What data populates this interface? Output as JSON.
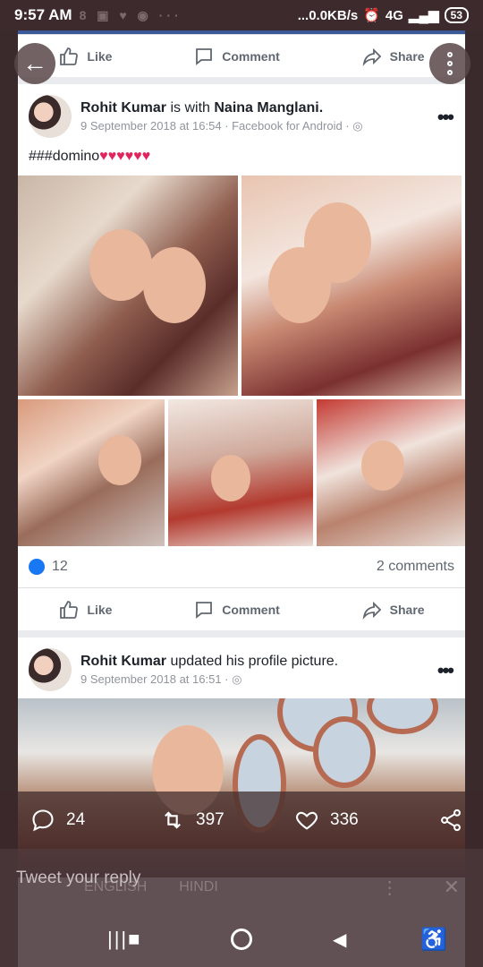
{
  "status_bar": {
    "time": "9:57 AM",
    "faded_icons": "8 ▣ ♥ ◉ ···",
    "network_speed": "...0.0KB/s",
    "signal": "4G",
    "battery": "53"
  },
  "post_actions_top": {
    "like": "Like",
    "comment": "Comment",
    "share": "Share"
  },
  "post1": {
    "author": "Rohit Kumar",
    "with_text": "is with",
    "tagged": "Naina Manglani.",
    "meta": "9 September 2018 at 16:54 · Facebook for Android ·",
    "caption": "###domino",
    "hearts": "♥♥♥♥♥♥",
    "like_count": "12",
    "comments": "2 comments",
    "actions": {
      "like": "Like",
      "comment": "Comment",
      "share": "Share"
    }
  },
  "post2": {
    "author": "Rohit Kumar",
    "action_text": "updated his profile picture.",
    "meta": "9 September 2018 at 16:51 ·"
  },
  "tweet_bar": {
    "replies": "24",
    "retweets": "397",
    "likes": "336"
  },
  "reply": {
    "placeholder": "Tweet your reply"
  },
  "keyboard": {
    "lang1": "ENGLISH",
    "lang2": "HINDI"
  }
}
